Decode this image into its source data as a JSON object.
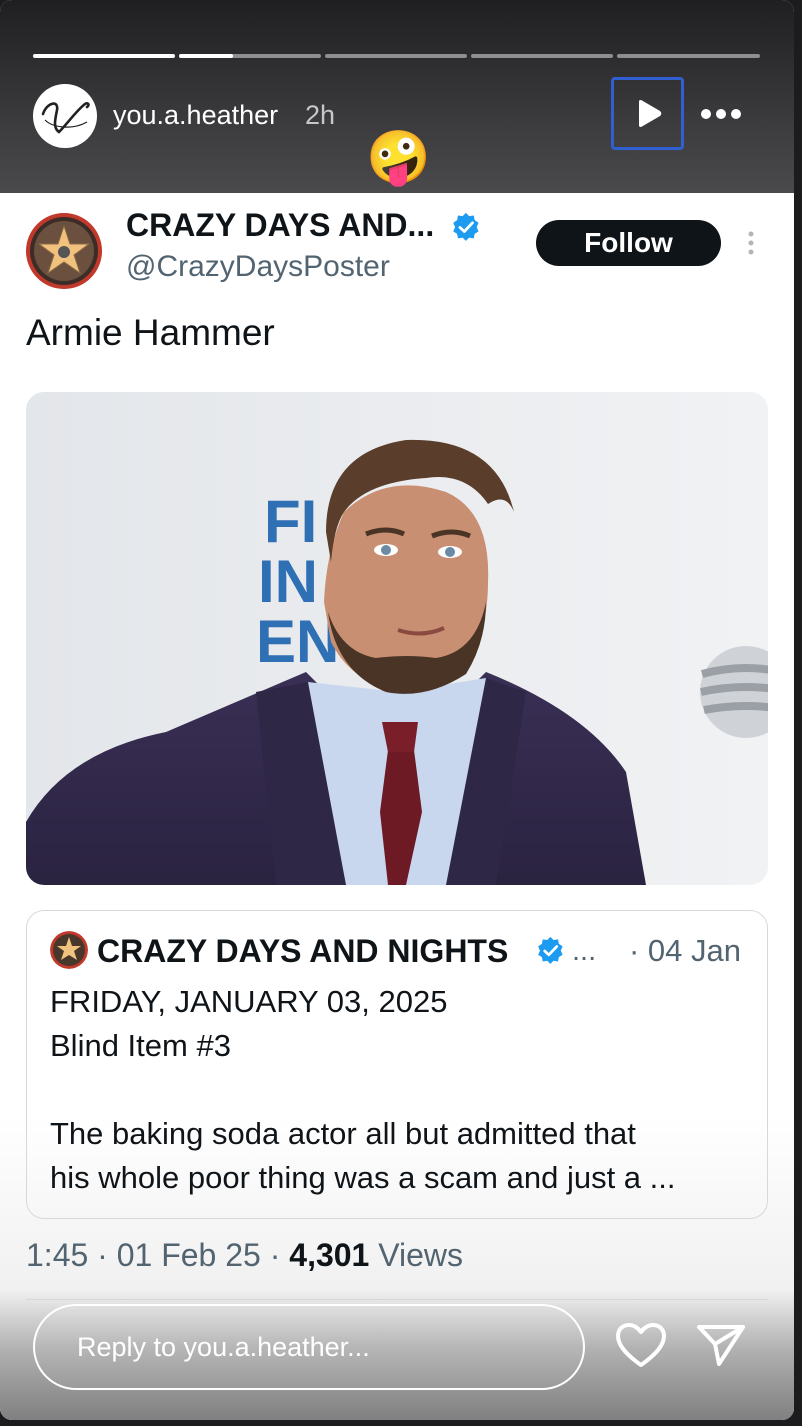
{
  "story": {
    "username": "you.a.heather",
    "time_ago": "2h",
    "progress": [
      1.0,
      0.38,
      0,
      0,
      0
    ],
    "avatar_icon": "script-v-monogram",
    "sticker_emoji": "🤪",
    "reply_placeholder": "Reply to you.a.heather...",
    "controls": [
      "play-icon",
      "more-icon",
      "heart-icon",
      "send-icon"
    ]
  },
  "tweet": {
    "account_name": "CRAZY DAYS AND...",
    "handle": "@CrazyDaysPoster",
    "follow_label": "Follow",
    "text": "Armie Hammer",
    "timestamp": "1:45 · 01 Feb 25 · ",
    "views_count": "4,301",
    "views_label": " Views",
    "verified_color": "#1d9bf0"
  },
  "quoted_tweet": {
    "account_name": "CRAZY DAYS AND NIGHTS",
    "ellipsis": "...",
    "date": "· 04 Jan",
    "lines": [
      "FRIDAY, JANUARY 03, 2025",
      "Blind Item #3",
      "The baking soda actor all but admitted that",
      "his whole poor thing was a scam and just a ..."
    ]
  }
}
